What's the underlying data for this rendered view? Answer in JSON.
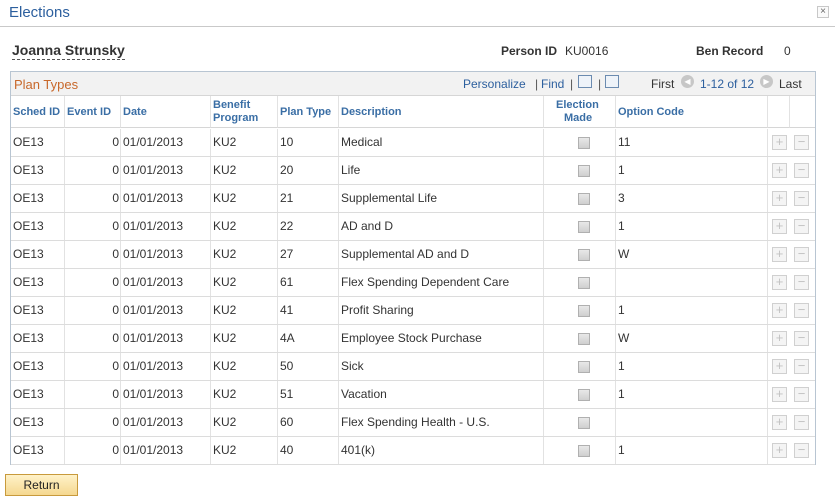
{
  "window": {
    "title": "Elections",
    "close_glyph": "×"
  },
  "employee": {
    "name": "Joanna Strunsky",
    "person_id_label": "Person ID",
    "person_id": "KU0016",
    "ben_record_label": "Ben Record",
    "ben_record": "0"
  },
  "grid": {
    "title": "Plan Types",
    "personalize": "Personalize",
    "find": "Find",
    "first": "First",
    "range": "1-12 of 12",
    "last": "Last",
    "separator": "|"
  },
  "columns": {
    "sched_id": "Sched ID",
    "event_id": "Event ID",
    "date": "Date",
    "benefit_program_1": "Benefit",
    "benefit_program_2": "Program",
    "plan_type": "Plan Type",
    "description": "Description",
    "election_made_1": "Election",
    "election_made_2": "Made",
    "option_code": "Option Code"
  },
  "rows": [
    {
      "sched_id": "OE13",
      "event_id": "0",
      "date": "01/01/2013",
      "program": "KU2",
      "plan_type": "10",
      "description": "Medical",
      "option_code": "11"
    },
    {
      "sched_id": "OE13",
      "event_id": "0",
      "date": "01/01/2013",
      "program": "KU2",
      "plan_type": "20",
      "description": "Life",
      "option_code": "1"
    },
    {
      "sched_id": "OE13",
      "event_id": "0",
      "date": "01/01/2013",
      "program": "KU2",
      "plan_type": "21",
      "description": "Supplemental Life",
      "option_code": "3"
    },
    {
      "sched_id": "OE13",
      "event_id": "0",
      "date": "01/01/2013",
      "program": "KU2",
      "plan_type": "22",
      "description": "AD and D",
      "option_code": "1"
    },
    {
      "sched_id": "OE13",
      "event_id": "0",
      "date": "01/01/2013",
      "program": "KU2",
      "plan_type": "27",
      "description": "Supplemental AD and D",
      "option_code": "W"
    },
    {
      "sched_id": "OE13",
      "event_id": "0",
      "date": "01/01/2013",
      "program": "KU2",
      "plan_type": "61",
      "description": "Flex Spending Dependent Care",
      "option_code": ""
    },
    {
      "sched_id": "OE13",
      "event_id": "0",
      "date": "01/01/2013",
      "program": "KU2",
      "plan_type": "41",
      "description": "Profit Sharing",
      "option_code": "1"
    },
    {
      "sched_id": "OE13",
      "event_id": "0",
      "date": "01/01/2013",
      "program": "KU2",
      "plan_type": "4A",
      "description": "Employee Stock Purchase",
      "option_code": "W"
    },
    {
      "sched_id": "OE13",
      "event_id": "0",
      "date": "01/01/2013",
      "program": "KU2",
      "plan_type": "50",
      "description": "Sick",
      "option_code": "1"
    },
    {
      "sched_id": "OE13",
      "event_id": "0",
      "date": "01/01/2013",
      "program": "KU2",
      "plan_type": "51",
      "description": "Vacation",
      "option_code": "1"
    },
    {
      "sched_id": "OE13",
      "event_id": "0",
      "date": "01/01/2013",
      "program": "KU2",
      "plan_type": "60",
      "description": "Flex Spending Health - U.S.",
      "option_code": ""
    },
    {
      "sched_id": "OE13",
      "event_id": "0",
      "date": "01/01/2013",
      "program": "KU2",
      "plan_type": "40",
      "description": "401(k)",
      "option_code": "1"
    }
  ],
  "row_buttons": {
    "add": "+",
    "delete": "−"
  },
  "nav_icons": {
    "prev": "◀",
    "next": "▶"
  },
  "return_button": "Return"
}
